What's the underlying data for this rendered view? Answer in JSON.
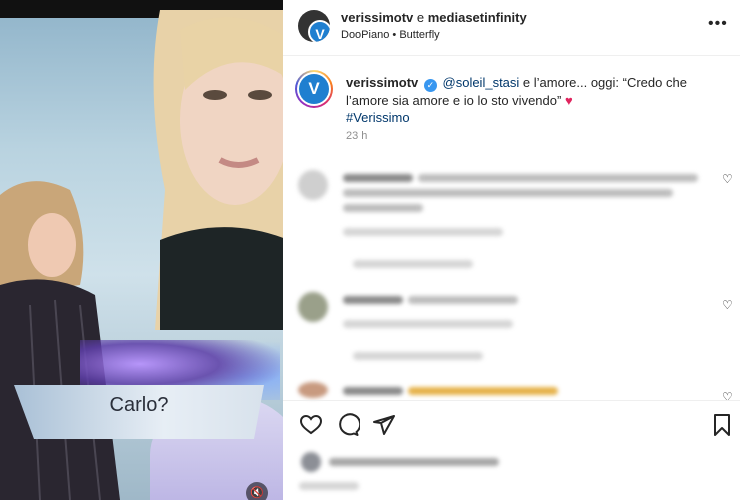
{
  "media": {
    "caption": "Carlo?"
  },
  "header": {
    "account": "verissimotv",
    "connector": "e",
    "partner": "mediasetinfinity",
    "audio_artist": "DooPiano",
    "audio_separator": "•",
    "audio_track": "Butterfly",
    "avatar_letter": "V"
  },
  "post": {
    "username": "verissimotv",
    "mention": "@soleil_stasi",
    "text": " e l’amore... oggi: “Credo che l’amore sia amore e io lo sto vivendo” ",
    "heart": "♥",
    "hashtag": "#Verissimo",
    "time": "23 h",
    "avatar_letter": "V"
  },
  "icons": {
    "more": "more-horizontal-icon",
    "like": "heart-icon",
    "comment": "comment-icon",
    "share": "send-icon",
    "save": "bookmark-icon"
  },
  "colors": {
    "link": "#00376b",
    "brand": "#1f7fd0",
    "heart": "#e0245e"
  }
}
